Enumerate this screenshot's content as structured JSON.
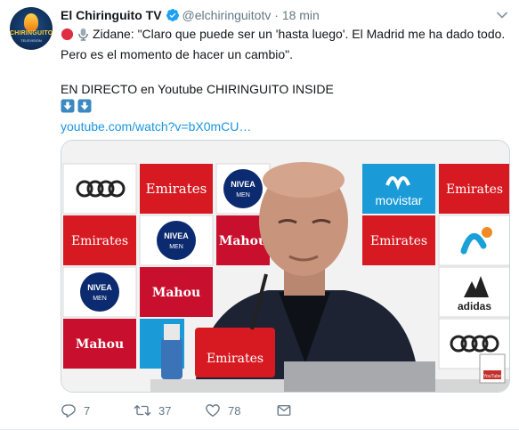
{
  "account": {
    "name": "El Chiringuito TV",
    "handle": "@elchiringuitotv",
    "separator": "·",
    "time": "18 min",
    "avatar_text": "CHIRINGUITO",
    "avatar_sub": "TELEVISION"
  },
  "tweet": {
    "line1": "Zidane: \"Claro que puede ser un 'hasta luego'. El Madrid me ha dado todo.",
    "line2": "Pero es el momento de hacer un cambio\".",
    "line3": "EN DIRECTO en Youtube CHIRINGUITO INSIDE",
    "link": "youtube.com/watch?v=bX0mCU…"
  },
  "media": {
    "sponsors": [
      "Emirates",
      "NIVEA MEN",
      "Mahou",
      "movistar",
      "adidas"
    ],
    "corner_badge": "YouTube"
  },
  "actions": {
    "replies": "7",
    "retweets": "37",
    "likes": "78"
  },
  "colors": {
    "link": "#1b95e0",
    "verified": "#1da1f2",
    "muted": "#657786",
    "emirates_red": "#d71a21",
    "nivea_navy": "#0b2a6f",
    "movistar_blue": "#1a9bd7"
  }
}
